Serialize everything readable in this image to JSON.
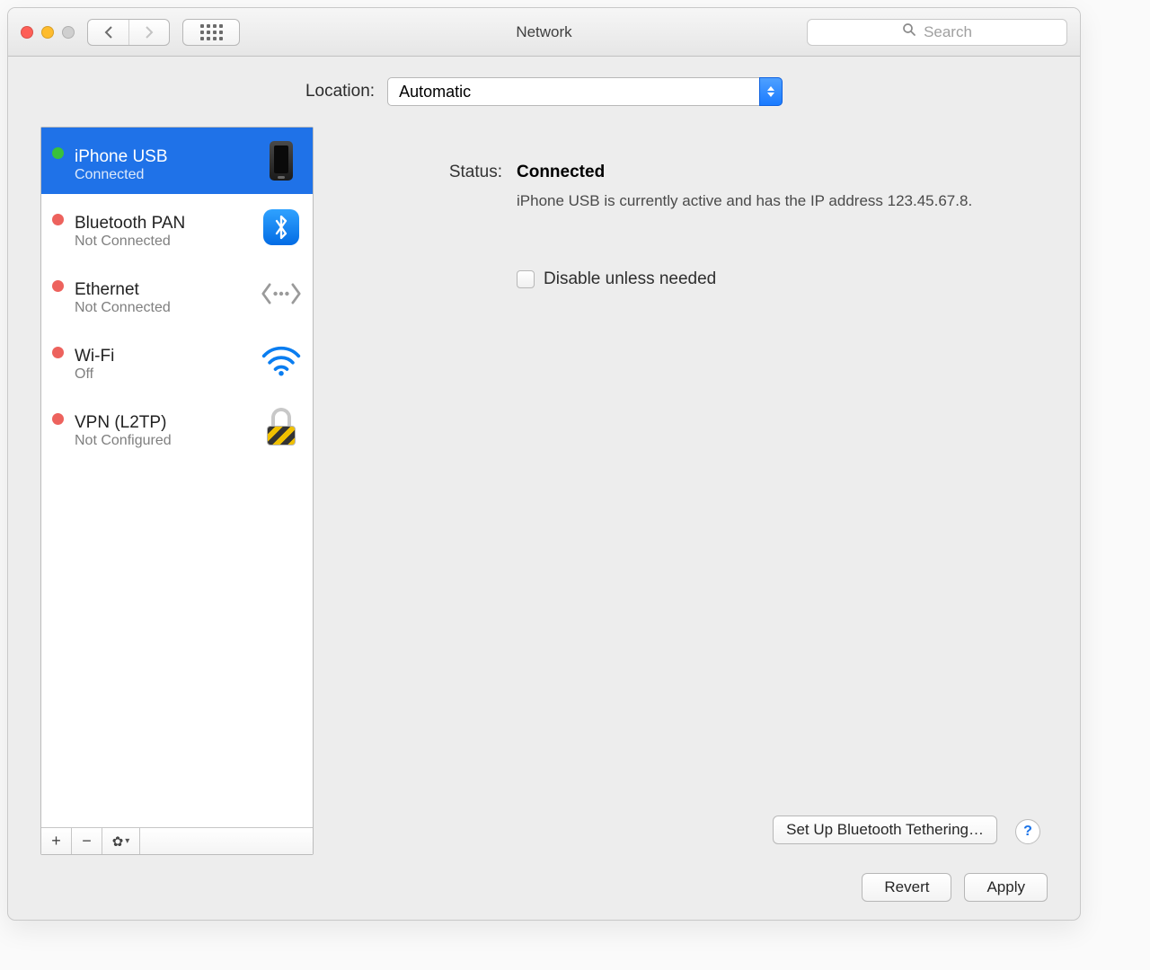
{
  "window": {
    "title": "Network"
  },
  "search": {
    "placeholder": "Search"
  },
  "location": {
    "label": "Location:",
    "value": "Automatic"
  },
  "sidebar": {
    "items": [
      {
        "name": "iPhone USB",
        "sub": "Connected",
        "status": "green",
        "icon": "phone",
        "selected": true
      },
      {
        "name": "Bluetooth PAN",
        "sub": "Not Connected",
        "status": "red",
        "icon": "bluetooth",
        "selected": false
      },
      {
        "name": "Ethernet",
        "sub": "Not Connected",
        "status": "red",
        "icon": "ethernet",
        "selected": false
      },
      {
        "name": "Wi-Fi",
        "sub": "Off",
        "status": "red",
        "icon": "wifi",
        "selected": false
      },
      {
        "name": "VPN (L2TP)",
        "sub": "Not Configured",
        "status": "red",
        "icon": "lock",
        "selected": false
      }
    ]
  },
  "detail": {
    "status_label": "Status:",
    "status_value": "Connected",
    "description": "iPhone USB is currently active and has the IP address 123.45.67.8.",
    "disable_label": "Disable unless needed",
    "setup_button": "Set Up Bluetooth Tethering…",
    "help": "?"
  },
  "bottom": {
    "revert": "Revert",
    "apply": "Apply"
  }
}
